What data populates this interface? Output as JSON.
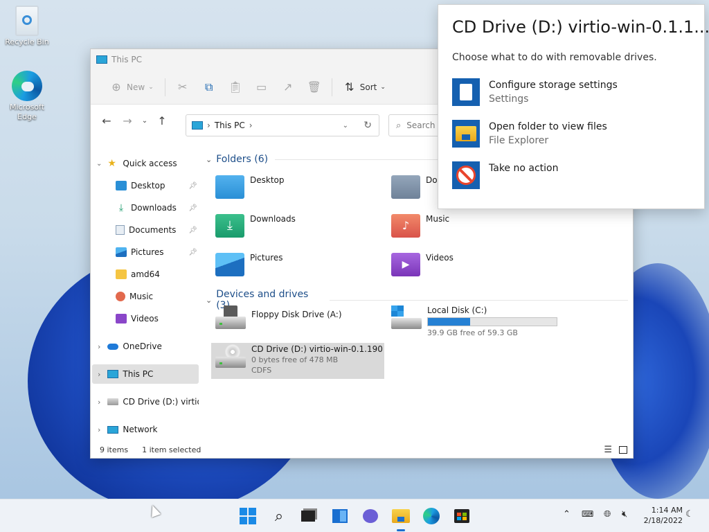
{
  "desktop": {
    "icons": [
      {
        "label": "Recycle Bin",
        "icon": "recycle-bin-icon"
      },
      {
        "label": "Microsoft Edge",
        "icon": "edge-icon"
      }
    ]
  },
  "explorer": {
    "title": "This PC",
    "commandbar": {
      "new_label": "New",
      "sort_label": "Sort",
      "icons": [
        "cut-icon",
        "copy-icon",
        "paste-icon",
        "rename-icon",
        "share-icon",
        "delete-icon"
      ]
    },
    "address": {
      "path": "This PC",
      "separator": "›"
    },
    "search": {
      "placeholder": "Search"
    },
    "sidebar": {
      "quick_access": "Quick access",
      "pinned": [
        {
          "label": "Desktop",
          "icon": "desktop-folder-icon"
        },
        {
          "label": "Downloads",
          "icon": "download-icon"
        },
        {
          "label": "Documents",
          "icon": "documents-icon"
        },
        {
          "label": "Pictures",
          "icon": "pictures-icon"
        }
      ],
      "recent": [
        {
          "label": "amd64",
          "icon": "folder-icon"
        },
        {
          "label": "Music",
          "icon": "music-icon"
        },
        {
          "label": "Videos",
          "icon": "videos-icon"
        }
      ],
      "onedrive": "OneDrive",
      "this_pc": "This PC",
      "cd_drive": "CD Drive (D:) virtio-w",
      "network": "Network"
    },
    "folders_header": "Folders (6)",
    "folders": [
      {
        "name": "Desktop",
        "icon": "desktop-folder-icon",
        "color": "#2a8fd6"
      },
      {
        "name": "Documents",
        "icon": "documents-folder-icon",
        "color": "#6f8299"
      },
      {
        "name": "Downloads",
        "icon": "downloads-folder-icon",
        "color": "#1a9b6c"
      },
      {
        "name": "Music",
        "icon": "music-folder-icon",
        "color": "#e2694d"
      },
      {
        "name": "Pictures",
        "icon": "pictures-folder-icon",
        "color": "#2f8fdc"
      },
      {
        "name": "Videos",
        "icon": "videos-folder-icon",
        "color": "#8a46c9"
      }
    ],
    "devices_header": "Devices and drives (3)",
    "drives": [
      {
        "name": "Floppy Disk Drive (A:)",
        "icon": "floppy-drive-icon"
      },
      {
        "name": "Local Disk (C:)",
        "icon": "local-disk-icon",
        "free": "39.9 GB free of 59.3 GB",
        "used_fraction": 0.33
      },
      {
        "name": "CD Drive (D:) virtio-win-0.1.190",
        "icon": "cd-drive-icon",
        "free": "0 bytes free of 478 MB",
        "fs": "CDFS"
      }
    ],
    "status": {
      "items": "9 items",
      "selected": "1 item selected"
    }
  },
  "popup": {
    "title": "CD Drive (D:) virtio-win-0.1.1...",
    "subtitle": "Choose what to do with removable drives.",
    "options": [
      {
        "title": "Configure storage settings",
        "sub": "Settings",
        "icon": "storage-settings-icon"
      },
      {
        "title": "Open folder to view files",
        "sub": "File Explorer",
        "icon": "file-explorer-icon"
      },
      {
        "title": "Take no action",
        "sub": "",
        "icon": "no-action-icon"
      }
    ]
  },
  "taskbar": {
    "apps": [
      "start-icon",
      "search-icon",
      "task-view-icon",
      "widgets-icon",
      "chat-icon",
      "file-explorer-icon",
      "edge-icon",
      "store-icon"
    ],
    "time": "1:14 AM",
    "date": "2/18/2022"
  }
}
